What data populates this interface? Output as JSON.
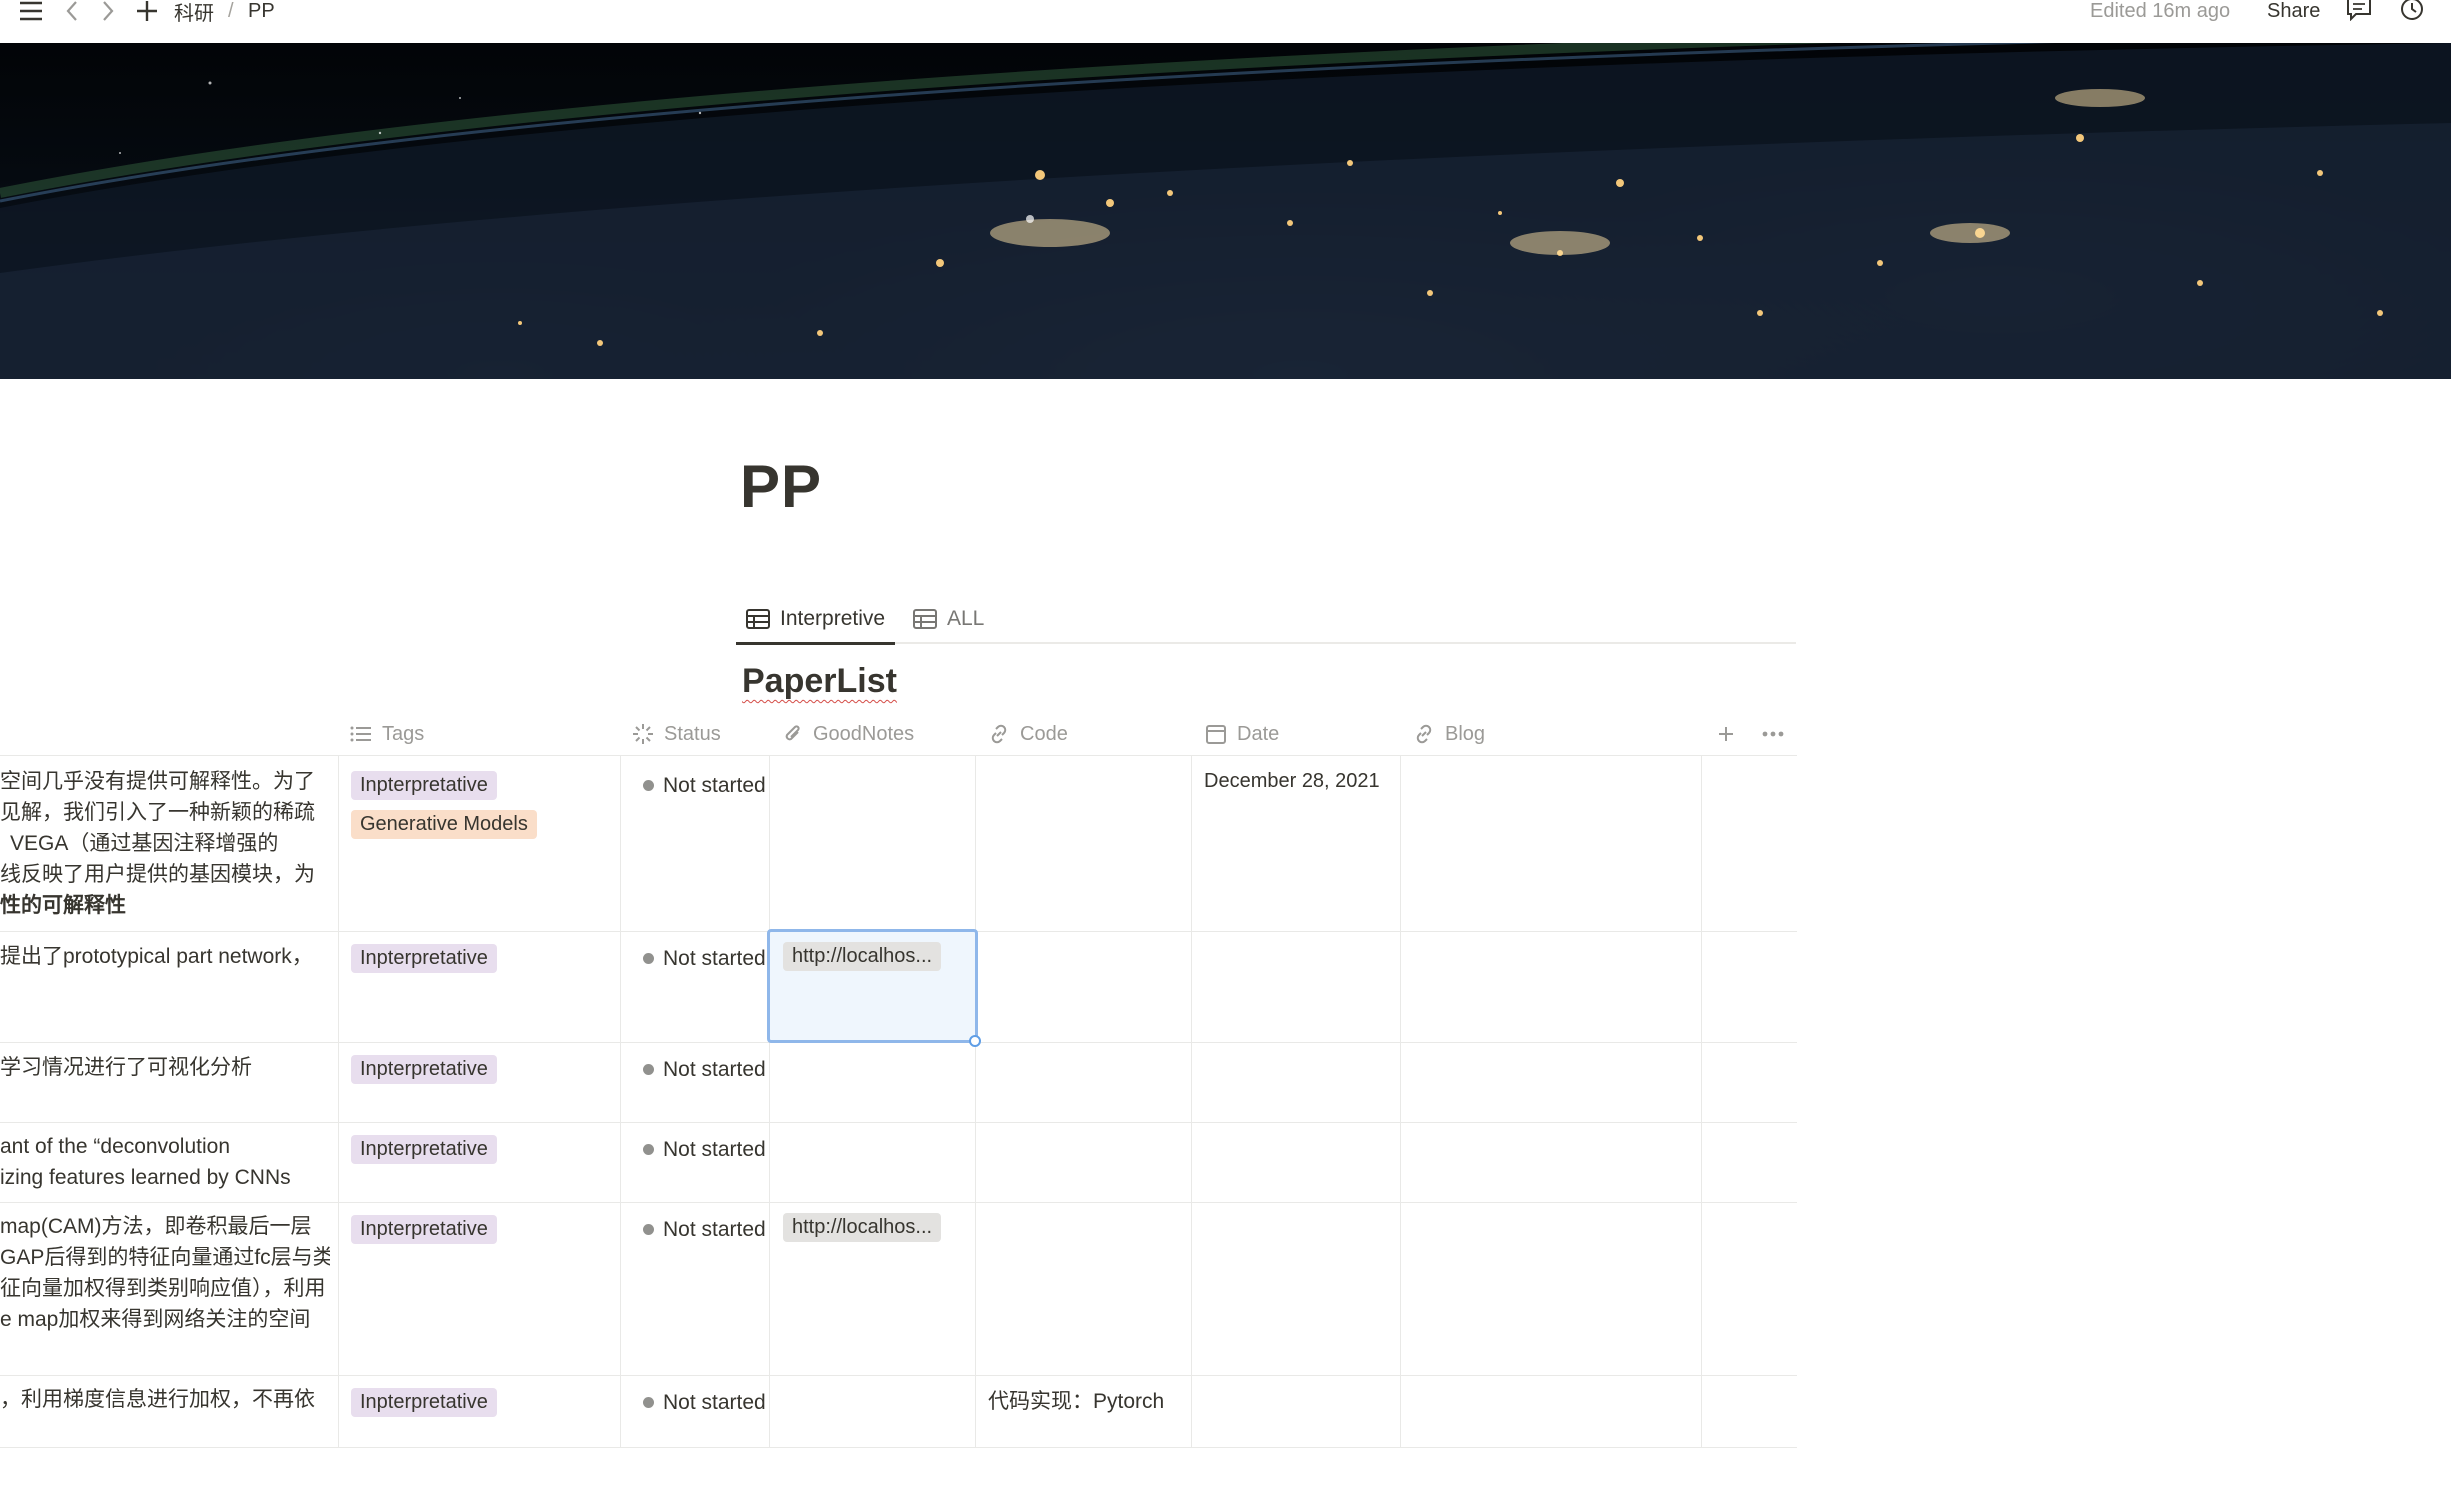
{
  "topbar": {
    "breadcrumb": [
      "科研",
      "PP"
    ],
    "breadcrumb_sep": "/",
    "edited": "Edited 16m ago",
    "share": "Share"
  },
  "page": {
    "title": "PP"
  },
  "views": {
    "tabs": [
      {
        "label": "Interpretive",
        "active": true
      },
      {
        "label": "ALL",
        "active": false
      }
    ]
  },
  "database": {
    "title": "PaperList",
    "columns": [
      "Tags",
      "Status",
      "GoodNotes",
      "Code",
      "Date",
      "Blog"
    ],
    "rows": [
      {
        "desc": [
          "空间几乎没有提供可解释性。为了",
          "见解，我们引入了一种新颖的稀疏",
          "VEGA（通过基因注释增强的",
          "线反映了用户提供的基因模块，为",
          "性的可解释性"
        ],
        "tags": [
          "Inpterpretative",
          "Generative Models"
        ],
        "status": "Not started",
        "goodnotes": "",
        "code": "",
        "date": "December 28, 2021"
      },
      {
        "desc": [
          "提出了prototypical part network，"
        ],
        "tags": [
          "Inpterpretative"
        ],
        "status": "Not started",
        "goodnotes": "http://localhos...",
        "code": "",
        "date": ""
      },
      {
        "desc": [
          "学习情况进行了可视化分析"
        ],
        "tags": [
          "Inpterpretative"
        ],
        "status": "Not started",
        "goodnotes": "",
        "code": "",
        "date": ""
      },
      {
        "desc": [
          "ant of the “deconvolution",
          "izing features learned by CNNs"
        ],
        "tags": [
          "Inpterpretative"
        ],
        "status": "Not started",
        "goodnotes": "",
        "code": "",
        "date": ""
      },
      {
        "desc": [
          "map(CAM)方法，即卷积最后一层",
          "GAP后得到的特征向量通过fc层与类",
          "征向量加权得到类别响应值），利用",
          "e map加权来得到网络关注的空间"
        ],
        "tags": [
          "Inpterpretative"
        ],
        "status": "Not started",
        "goodnotes": "http://localhos...",
        "code": "",
        "date": ""
      },
      {
        "desc": [
          "，利用梯度信息进行加权，不再依"
        ],
        "tags": [
          "Inpterpretative"
        ],
        "status": "Not started",
        "goodnotes": "",
        "code": "代码实现：Pytorch",
        "date": ""
      }
    ]
  },
  "colors": {
    "tag_purple": "#e8deee",
    "tag_orange": "#fadec9",
    "status_dot": "#91918e",
    "selection": "#8fb7ea"
  }
}
